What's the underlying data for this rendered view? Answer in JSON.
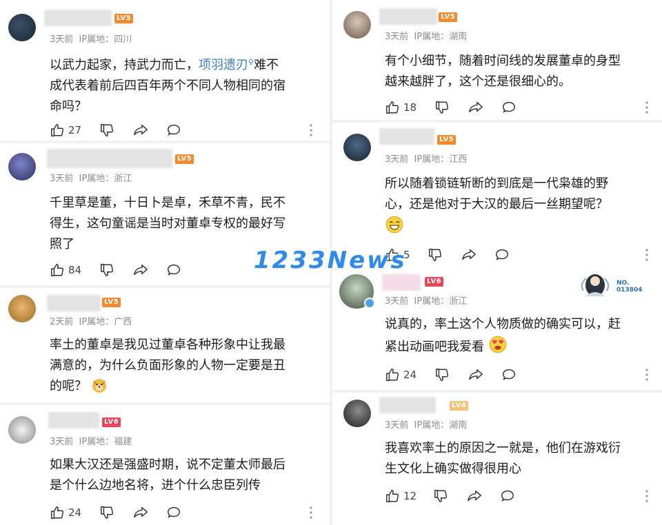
{
  "left": [
    {
      "level": "LV5",
      "time": "3天前",
      "ip_label": "IP属地：四川",
      "lines": [
        [
          "以武力起家，持武力而亡，",
          "项羽遗刃",
          "难不"
        ],
        [
          "成代表着前后四百年两个不同人物相同的宿"
        ],
        [
          "命吗？"
        ]
      ],
      "likes": "27"
    },
    {
      "level": "LV5",
      "time": "3天前",
      "ip_label": "IP属地：浙江",
      "lines": [
        [
          "千里草是董，十日卜是卓，禾草不青，民不"
        ],
        [
          "得生，这句童谣是当时对董卓专权的最好写"
        ],
        [
          "照了"
        ]
      ],
      "likes": "84"
    },
    {
      "level": "LV5",
      "time": "2天前",
      "ip_label": "IP属地：广西",
      "lines": [
        [
          "率土的董卓是我见过董卓各种形象中让我最"
        ],
        [
          "满意的，为什么负面形象的人物一定要是丑"
        ],
        [
          "的呢？"
        ]
      ],
      "likes": ""
    },
    {
      "level": "LV6",
      "time": "3天前",
      "ip_label": "IP属地：福建",
      "lines": [
        [
          "如果大汉还是强盛时期，说不定董太师最后"
        ],
        [
          "是个什么边地名将，进个什么忠臣列传"
        ]
      ],
      "likes": "24"
    }
  ],
  "right": [
    {
      "level": "LV5",
      "time": "3天前",
      "ip_label": "IP属地：湖南",
      "lines": [
        [
          "有个小细节，随着时间线的发展董卓的身型"
        ],
        [
          "越来越胖了，这个还是很细心的。"
        ]
      ],
      "likes": "18"
    },
    {
      "level": "LV5",
      "time": "3天前",
      "ip_label": "IP属地：江西",
      "lines": [
        [
          "所以随着锁链斩断的到底是一代枭雄的野"
        ],
        [
          "心，还是他对于大汉的最后一丝期望呢？"
        ]
      ],
      "likes": "5"
    },
    {
      "level": "LV6",
      "time": "3天前",
      "ip_label": "IP属地：浙江",
      "lines": [
        [
          "说真的，率土这个人物质做的确实可以，赶"
        ],
        [
          "紧出动画吧我爱看"
        ]
      ],
      "likes": "24"
    },
    {
      "level": "LV4",
      "time": "3天前",
      "ip_label": "IP属地：湖南",
      "lines": [
        [
          "我喜欢率土的原因之一就是，他们在游戏衍"
        ],
        [
          "生文化上确实做得很用心"
        ]
      ],
      "likes": "12"
    }
  ],
  "watermark": "1233News",
  "no_badge": [
    "NO.",
    "013804"
  ],
  "colors": {
    "link": "#3d7fc1",
    "lv5": "#f28a30",
    "lv6": "#e8455a",
    "meta": "#8d8d8d"
  }
}
